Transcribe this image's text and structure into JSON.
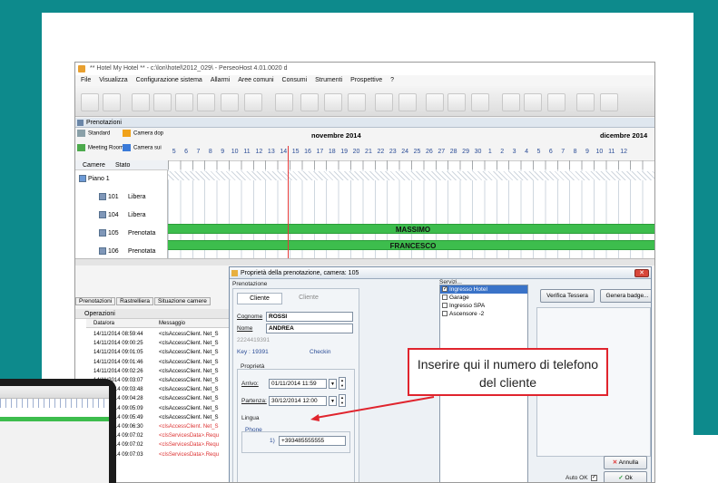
{
  "window": {
    "title": "** Hotel My Hotel ** - c:\\lon\\hotel\\2012_029\\ - PerseoHost 4.01.0020 d"
  },
  "menu": [
    "File",
    "Visualizza",
    "Configurazione sistema",
    "Allarmi",
    "Aree comuni",
    "Consumi",
    "Strumenti",
    "Prospettive",
    "?"
  ],
  "panel_title": "Prenotazioni",
  "legend": [
    {
      "label": "Standard",
      "color": "#8aa0a8"
    },
    {
      "label": "Camera dop",
      "color": "#f0a21a"
    },
    {
      "label": "Meeting Room",
      "color": "#4caa4c"
    },
    {
      "label": "Camera sui",
      "color": "#3a7ad8"
    }
  ],
  "calendar": {
    "month1": "novembre 2014",
    "month2": "dicembre 2014",
    "days": [
      "5",
      "6",
      "7",
      "8",
      "9",
      "10",
      "11",
      "12",
      "13",
      "14",
      "15",
      "16",
      "17",
      "18",
      "19",
      "20",
      "21",
      "22",
      "23",
      "24",
      "25",
      "26",
      "27",
      "28",
      "29",
      "30",
      "1",
      "2",
      "3",
      "4",
      "5",
      "6",
      "7",
      "8",
      "9",
      "10",
      "11",
      "12"
    ]
  },
  "tree": {
    "col_camere": "Camere",
    "col_stato": "Stato",
    "floor": "Piano 1",
    "rooms": [
      {
        "num": "101",
        "state": "Libera"
      },
      {
        "num": "104",
        "state": "Libera"
      },
      {
        "num": "105",
        "state": "Prenotata"
      },
      {
        "num": "106",
        "state": "Prenotata"
      }
    ]
  },
  "bookings": [
    "MASSIMO",
    "FRANCESCO"
  ],
  "bottom_tabs": [
    "Prenotazioni",
    "Rastrelliera",
    "Situazione camere"
  ],
  "operazioni": {
    "title": "Operazioni",
    "col_date": "Data/ora",
    "col_msg": "Messaggio",
    "rows": [
      {
        "t": "14/11/2014 08:59:44",
        "m": "<clsAccessClient. Net_S"
      },
      {
        "t": "14/11/2014 09:00:25",
        "m": "<clsAccessClient. Net_S"
      },
      {
        "t": "14/11/2014 09:01:05",
        "m": "<clsAccessClient. Net_S"
      },
      {
        "t": "14/11/2014 09:01:46",
        "m": "<clsAccessClient. Net_S"
      },
      {
        "t": "14/11/2014 09:02:26",
        "m": "<clsAccessClient. Net_S"
      },
      {
        "t": "14/11/2014 09:03:07",
        "m": "<clsAccessClient. Net_S"
      },
      {
        "t": "14/11/2014 09:03:48",
        "m": "<clsAccessClient. Net_S"
      },
      {
        "t": "14/11/2014 09:04:28",
        "m": "<clsAccessClient. Net_S"
      },
      {
        "t": "14/11/2014 09:05:09",
        "m": "<clsAccessClient. Net_S"
      },
      {
        "t": "14/11/2014 09:05:49",
        "m": "<clsAccessClient. Net_S"
      },
      {
        "t": "14/11/2014 09:06:30",
        "m": "<clsAccessClient. Net_S",
        "red": true
      },
      {
        "t": "14/11/2014 09:07:02",
        "m": "<clsServicesData>.Requ",
        "red": true
      },
      {
        "t": "14/11/2014 09:07:02",
        "m": "<clsServicesData>.Requ",
        "red": true
      },
      {
        "t": "14/11/2014 09:07:03",
        "m": "<clsServicesData>.Requ",
        "red": true
      }
    ]
  },
  "dialog": {
    "title": "Proprietà della prenotazione, camera: 105",
    "section_prenotazione": "Prenotazione",
    "tab_cliente": "Cliente",
    "tab_cliente2": "Cliente",
    "cognome_label": "Cognome",
    "cognome": "ROSSI",
    "nome_label": "Nome",
    "nome": "ANDREA",
    "id_code": "2224419391",
    "key": "Key : 19391",
    "checkin": "Checkin",
    "section_proprieta": "Proprietà",
    "arrivo_label": "Arrivo:",
    "arrivo": "01/11/2014 11:59",
    "partenza_label": "Partenza:",
    "partenza": "30/12/2014 12:00",
    "lingua_label": "Lingua",
    "phone_label": "Phone",
    "phone_index": "1)",
    "phone": "+393485555555",
    "servizi_label": "Servizi...",
    "servizi": [
      {
        "label": "Ingresso Hotel",
        "checked": true,
        "selected": true
      },
      {
        "label": "Garage",
        "checked": false
      },
      {
        "label": "Ingresso SPA",
        "checked": false
      },
      {
        "label": "Ascensore -2",
        "checked": false
      }
    ],
    "btn_verifica": "Verifica Tessera",
    "btn_badge": "Genera badge...",
    "btn_annulla": "Annulla",
    "auto_ok": "Auto OK",
    "btn_ok": "Ok"
  },
  "callout": "Inserire qui il numero di telefono del cliente"
}
